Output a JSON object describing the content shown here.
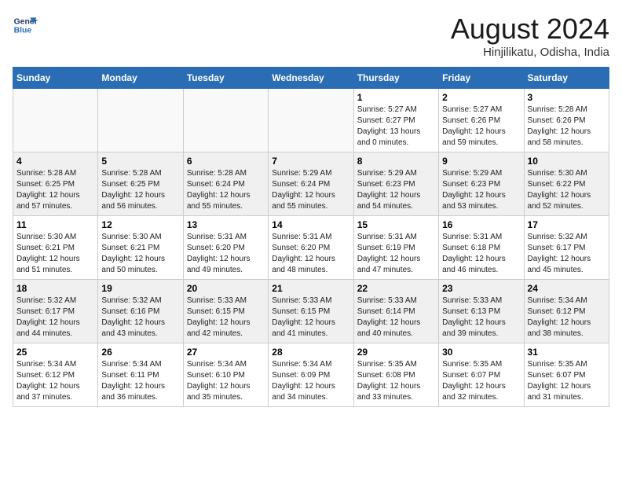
{
  "header": {
    "logo_line1": "General",
    "logo_line2": "Blue",
    "month_title": "August 2024",
    "location": "Hinjilikatu, Odisha, India"
  },
  "weekdays": [
    "Sunday",
    "Monday",
    "Tuesday",
    "Wednesday",
    "Thursday",
    "Friday",
    "Saturday"
  ],
  "weeks": [
    {
      "shaded": false,
      "days": [
        {
          "num": "",
          "info": ""
        },
        {
          "num": "",
          "info": ""
        },
        {
          "num": "",
          "info": ""
        },
        {
          "num": "",
          "info": ""
        },
        {
          "num": "1",
          "info": "Sunrise: 5:27 AM\nSunset: 6:27 PM\nDaylight: 13 hours\nand 0 minutes."
        },
        {
          "num": "2",
          "info": "Sunrise: 5:27 AM\nSunset: 6:26 PM\nDaylight: 12 hours\nand 59 minutes."
        },
        {
          "num": "3",
          "info": "Sunrise: 5:28 AM\nSunset: 6:26 PM\nDaylight: 12 hours\nand 58 minutes."
        }
      ]
    },
    {
      "shaded": true,
      "days": [
        {
          "num": "4",
          "info": "Sunrise: 5:28 AM\nSunset: 6:25 PM\nDaylight: 12 hours\nand 57 minutes."
        },
        {
          "num": "5",
          "info": "Sunrise: 5:28 AM\nSunset: 6:25 PM\nDaylight: 12 hours\nand 56 minutes."
        },
        {
          "num": "6",
          "info": "Sunrise: 5:28 AM\nSunset: 6:24 PM\nDaylight: 12 hours\nand 55 minutes."
        },
        {
          "num": "7",
          "info": "Sunrise: 5:29 AM\nSunset: 6:24 PM\nDaylight: 12 hours\nand 55 minutes."
        },
        {
          "num": "8",
          "info": "Sunrise: 5:29 AM\nSunset: 6:23 PM\nDaylight: 12 hours\nand 54 minutes."
        },
        {
          "num": "9",
          "info": "Sunrise: 5:29 AM\nSunset: 6:23 PM\nDaylight: 12 hours\nand 53 minutes."
        },
        {
          "num": "10",
          "info": "Sunrise: 5:30 AM\nSunset: 6:22 PM\nDaylight: 12 hours\nand 52 minutes."
        }
      ]
    },
    {
      "shaded": false,
      "days": [
        {
          "num": "11",
          "info": "Sunrise: 5:30 AM\nSunset: 6:21 PM\nDaylight: 12 hours\nand 51 minutes."
        },
        {
          "num": "12",
          "info": "Sunrise: 5:30 AM\nSunset: 6:21 PM\nDaylight: 12 hours\nand 50 minutes."
        },
        {
          "num": "13",
          "info": "Sunrise: 5:31 AM\nSunset: 6:20 PM\nDaylight: 12 hours\nand 49 minutes."
        },
        {
          "num": "14",
          "info": "Sunrise: 5:31 AM\nSunset: 6:20 PM\nDaylight: 12 hours\nand 48 minutes."
        },
        {
          "num": "15",
          "info": "Sunrise: 5:31 AM\nSunset: 6:19 PM\nDaylight: 12 hours\nand 47 minutes."
        },
        {
          "num": "16",
          "info": "Sunrise: 5:31 AM\nSunset: 6:18 PM\nDaylight: 12 hours\nand 46 minutes."
        },
        {
          "num": "17",
          "info": "Sunrise: 5:32 AM\nSunset: 6:17 PM\nDaylight: 12 hours\nand 45 minutes."
        }
      ]
    },
    {
      "shaded": true,
      "days": [
        {
          "num": "18",
          "info": "Sunrise: 5:32 AM\nSunset: 6:17 PM\nDaylight: 12 hours\nand 44 minutes."
        },
        {
          "num": "19",
          "info": "Sunrise: 5:32 AM\nSunset: 6:16 PM\nDaylight: 12 hours\nand 43 minutes."
        },
        {
          "num": "20",
          "info": "Sunrise: 5:33 AM\nSunset: 6:15 PM\nDaylight: 12 hours\nand 42 minutes."
        },
        {
          "num": "21",
          "info": "Sunrise: 5:33 AM\nSunset: 6:15 PM\nDaylight: 12 hours\nand 41 minutes."
        },
        {
          "num": "22",
          "info": "Sunrise: 5:33 AM\nSunset: 6:14 PM\nDaylight: 12 hours\nand 40 minutes."
        },
        {
          "num": "23",
          "info": "Sunrise: 5:33 AM\nSunset: 6:13 PM\nDaylight: 12 hours\nand 39 minutes."
        },
        {
          "num": "24",
          "info": "Sunrise: 5:34 AM\nSunset: 6:12 PM\nDaylight: 12 hours\nand 38 minutes."
        }
      ]
    },
    {
      "shaded": false,
      "days": [
        {
          "num": "25",
          "info": "Sunrise: 5:34 AM\nSunset: 6:12 PM\nDaylight: 12 hours\nand 37 minutes."
        },
        {
          "num": "26",
          "info": "Sunrise: 5:34 AM\nSunset: 6:11 PM\nDaylight: 12 hours\nand 36 minutes."
        },
        {
          "num": "27",
          "info": "Sunrise: 5:34 AM\nSunset: 6:10 PM\nDaylight: 12 hours\nand 35 minutes."
        },
        {
          "num": "28",
          "info": "Sunrise: 5:34 AM\nSunset: 6:09 PM\nDaylight: 12 hours\nand 34 minutes."
        },
        {
          "num": "29",
          "info": "Sunrise: 5:35 AM\nSunset: 6:08 PM\nDaylight: 12 hours\nand 33 minutes."
        },
        {
          "num": "30",
          "info": "Sunrise: 5:35 AM\nSunset: 6:07 PM\nDaylight: 12 hours\nand 32 minutes."
        },
        {
          "num": "31",
          "info": "Sunrise: 5:35 AM\nSunset: 6:07 PM\nDaylight: 12 hours\nand 31 minutes."
        }
      ]
    }
  ]
}
